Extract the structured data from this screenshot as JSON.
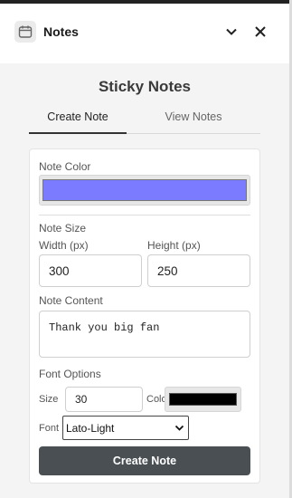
{
  "header": {
    "title": "Notes",
    "icon": "notes-app-icon",
    "collapse_icon": "chevron-down-icon",
    "close_icon": "close-icon"
  },
  "panel": {
    "title": "Sticky Notes",
    "tabs": [
      {
        "label": "Create Note",
        "active": true
      },
      {
        "label": "View Notes",
        "active": false
      }
    ]
  },
  "form": {
    "note_color": {
      "label": "Note Color",
      "value": "#7b7bff"
    },
    "note_size": {
      "label": "Note Size",
      "width_label": "Width (px)",
      "width_value": "300",
      "height_label": "Height (px)",
      "height_value": "250"
    },
    "note_content": {
      "label": "Note Content",
      "value": "Thank you big fan"
    },
    "font_options": {
      "label": "Font Options",
      "size_label": "Size",
      "size_value": "30",
      "color_label": "Color",
      "color_value": "#000000",
      "font_label": "Font",
      "font_value": "Lato-Light"
    },
    "submit_label": "Create Note"
  },
  "colors": {
    "button_bg": "#4a4f54",
    "panel_bg": "#f4f4f4"
  }
}
